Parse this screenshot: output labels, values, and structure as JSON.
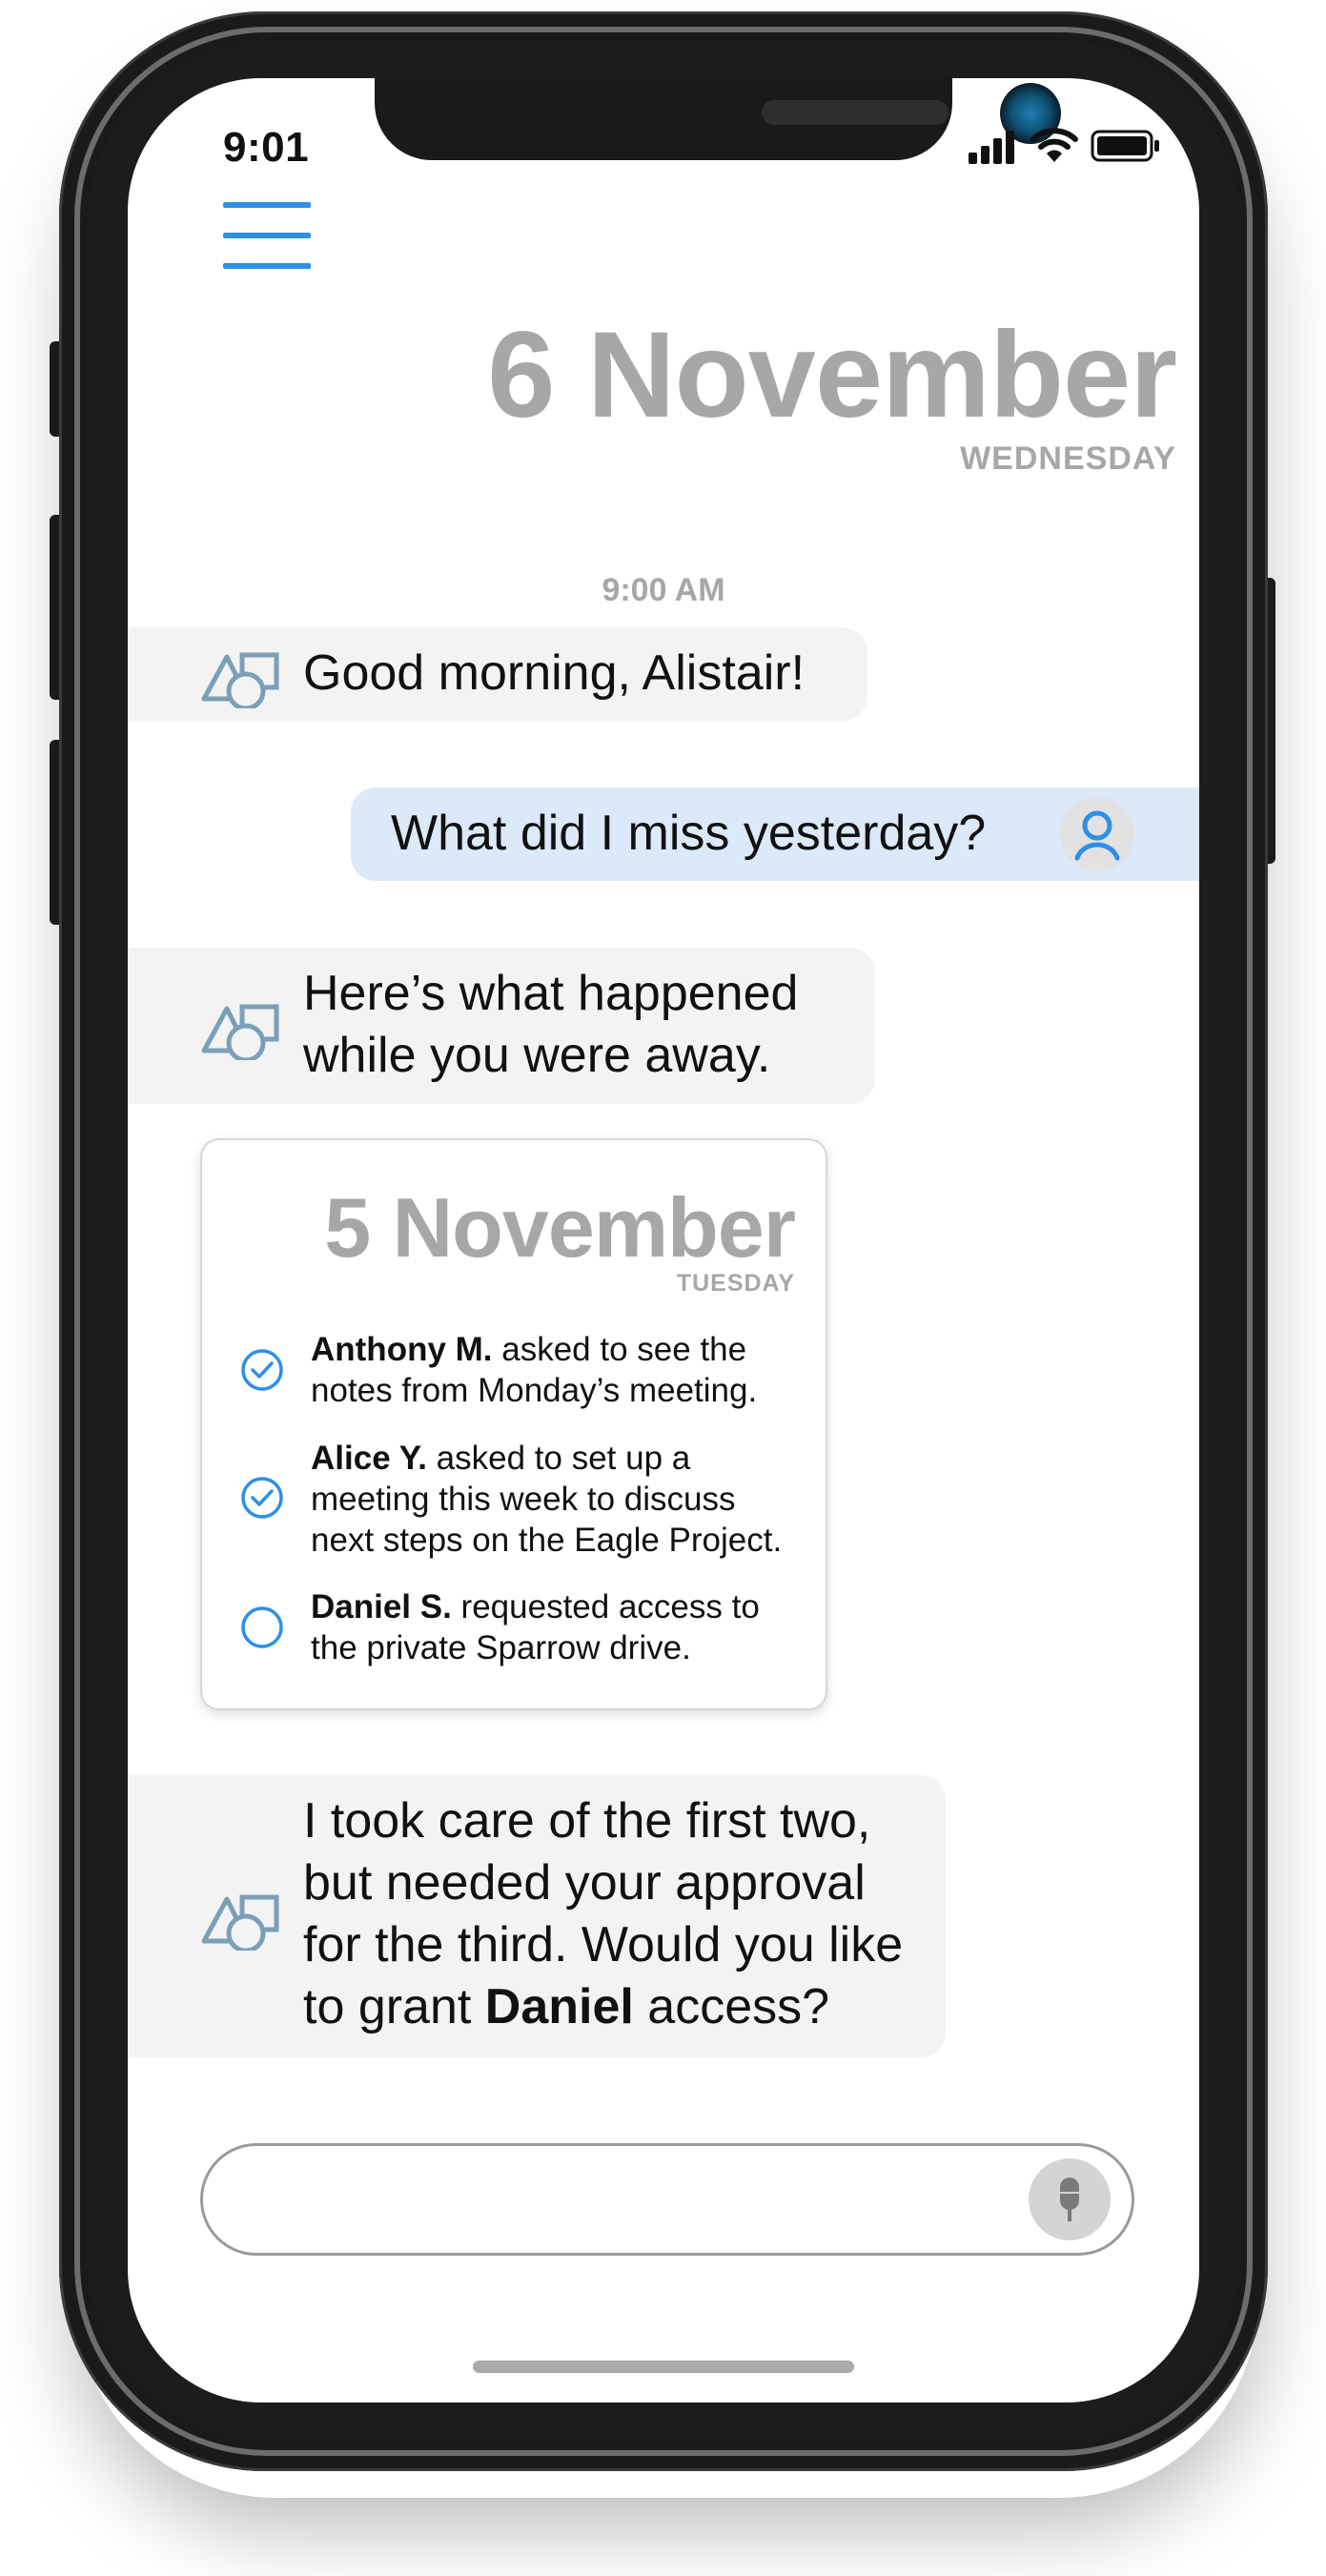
{
  "status_bar": {
    "time": "9:01",
    "icons": [
      "signal-icon",
      "wifi-icon",
      "battery-icon"
    ]
  },
  "header": {
    "date": "6 November",
    "weekday": "WEDNESDAY"
  },
  "conversation": {
    "timestamp": "9:00 AM",
    "messages": [
      {
        "sender": "assistant",
        "lines": [
          "Good morning, Alistair!"
        ]
      },
      {
        "sender": "user",
        "lines": [
          "What did I miss yesterday?"
        ]
      },
      {
        "sender": "assistant",
        "lines": [
          "Here’s what happened",
          "while you were away."
        ]
      },
      {
        "sender": "assistant",
        "lines": [
          "I took care of the first two,",
          "but needed your approval",
          "for the third. Would you like",
          "to grant ",
          "Daniel",
          " access?"
        ]
      }
    ]
  },
  "summary_card": {
    "date": "5 November",
    "weekday": "TUESDAY",
    "tasks": [
      {
        "name": "Anthony M.",
        "lines": [
          " asked to see the",
          "notes from Monday’s meeting."
        ],
        "done": true
      },
      {
        "name": "Alice Y.",
        "lines": [
          " asked to set up a",
          "meeting this week to discuss",
          "next steps on the Eagle Project."
        ],
        "done": true
      },
      {
        "name": "Daniel S.",
        "lines": [
          " requested access to",
          "the private Sparrow drive."
        ],
        "done": false
      }
    ]
  },
  "composer": {
    "value": "",
    "placeholder": ""
  },
  "colors": {
    "accent": "#2e8fe6",
    "muted_text": "#a7a7a7",
    "assistant_bubble": "#f3f3f3",
    "user_bubble": "#dbe9f8",
    "assistant_icon": "#7c9fb8"
  }
}
